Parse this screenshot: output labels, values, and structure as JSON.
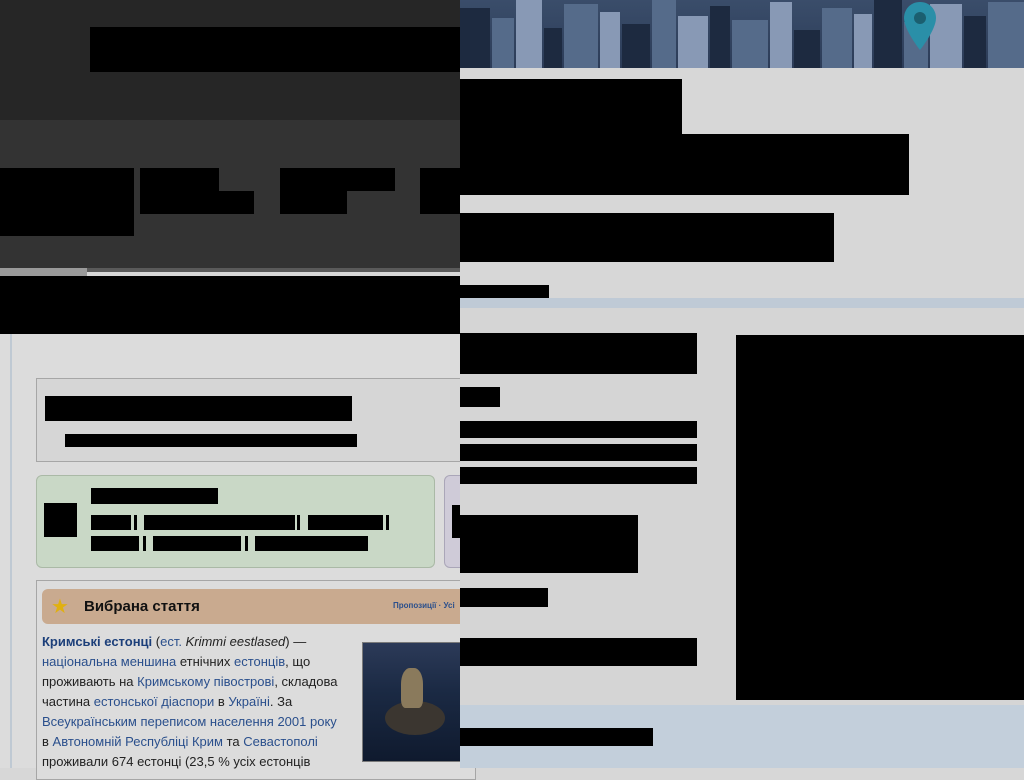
{
  "featured": {
    "title": "Вибрана стаття",
    "links": "Пропозиції · Усі",
    "star_icon": "star-icon",
    "text": {
      "t1": "Кримські естонці",
      "t2": " (",
      "t3": "ест.",
      "t4": " ",
      "t5": "Krimmi eestlased",
      "t6": ") — ",
      "t7": "національна меншина",
      "t8": " етнічних ",
      "t9": "естонців",
      "t10": ", що проживають на ",
      "t11": "Кримському півострові",
      "t12": ", складова частина ",
      "t13": "естонської діаспори",
      "t14": " в ",
      "t15": "Україні",
      "t16": ". За ",
      "t17": "Всеукраїнським переписом населення 2001 року",
      "t18": " в ",
      "t19": "Автономній Республіці Крим",
      "t20": " та ",
      "t21": "Севастополі",
      "t22": " проживали 674 естонці (23,5 % усіх естонців"
    }
  },
  "map": {
    "pin_icon": "map-pin-icon",
    "pin_color": "#2a8fa8"
  },
  "colors": {
    "featured_header": "#c9aa8f",
    "portal_green": "#c9d8c6",
    "link": "#2a4f8c"
  }
}
